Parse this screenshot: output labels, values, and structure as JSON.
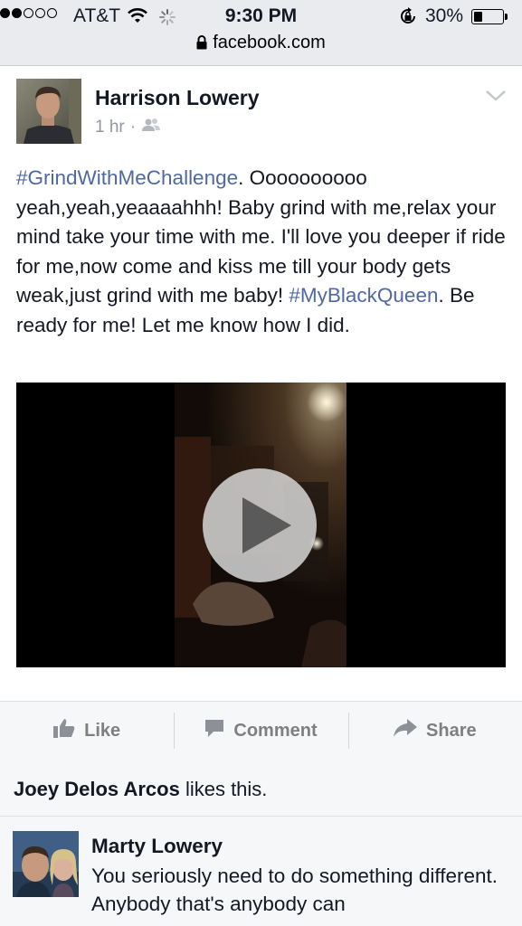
{
  "status_bar": {
    "carrier": "AT&T",
    "time": "9:30 PM",
    "battery": "30%",
    "battery_level": 0.3,
    "signal_strength": 2,
    "icons": [
      "wifi-icon",
      "loading-spinner-icon",
      "rotation-lock-icon",
      "battery-icon"
    ]
  },
  "browser": {
    "url": "facebook.com",
    "icon": "padlock-icon"
  },
  "post": {
    "author": "Harrison Lowery",
    "time": "1 hr",
    "separator": "·",
    "audience_icon": "friends-icon",
    "text_parts": {
      "hashtag1": "#GrindWithMeChallenge",
      "body1": ". Oooooooooo yeah,yeah,yeaaaahhh! Baby grind with me,relax your mind take your time with me. I'll love you deeper if ride for me,now come and kiss me till your body gets weak,just grind with me baby! ",
      "hashtag2": "#MyBlackQueen",
      "body2": ". Be ready for me! Let me know how I did."
    },
    "video_icon": "play-icon"
  },
  "actions": {
    "like": "Like",
    "comment": "Comment",
    "share": "Share"
  },
  "likes": {
    "name": "Joey Delos Arcos",
    "suffix": " likes this."
  },
  "comment": {
    "author": "Marty Lowery",
    "text": "You seriously need to do something different. Anybody that's anybody can"
  },
  "colors": {
    "link": "#4e69a2",
    "text": "#141823",
    "muted": "#9197a3",
    "bar_bg": "#f6f7f9"
  }
}
